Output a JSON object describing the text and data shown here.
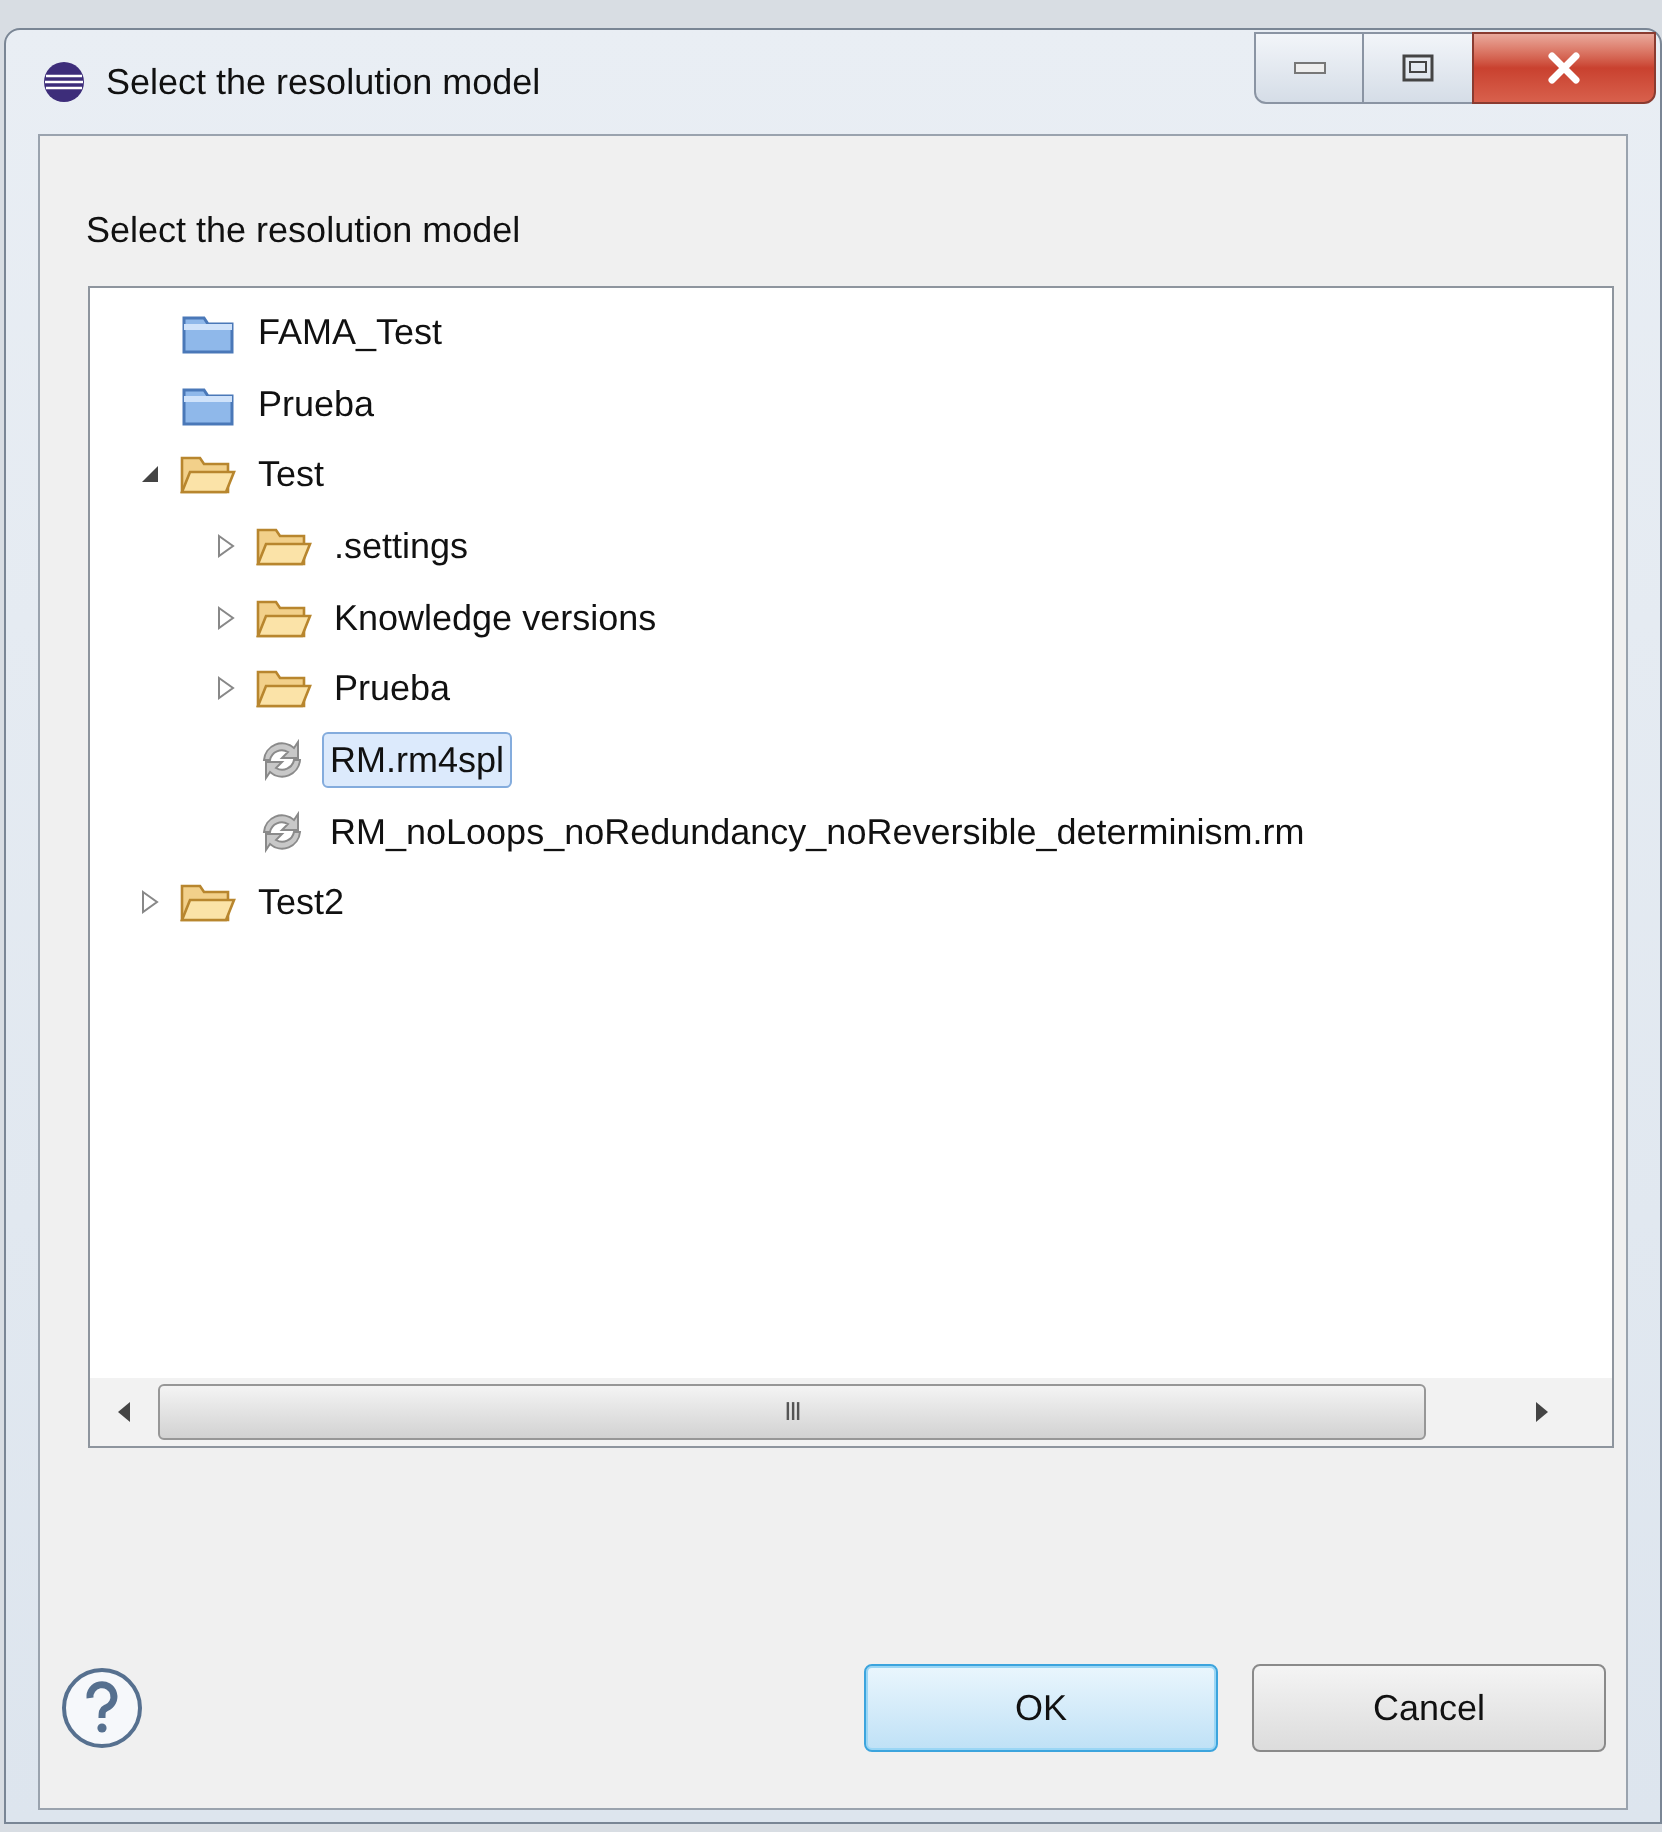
{
  "window": {
    "title": "Select the resolution model"
  },
  "message": "Select the resolution model",
  "tree": [
    {
      "label": "FAMA_Test",
      "kind": "project",
      "selected": false
    },
    {
      "label": "Prueba",
      "kind": "project",
      "selected": false
    },
    {
      "label": "Test",
      "kind": "folder",
      "expanded": true,
      "selected": false,
      "children": [
        {
          "label": ".settings",
          "kind": "folder",
          "expanded": false,
          "selected": false
        },
        {
          "label": "Knowledge versions",
          "kind": "folder",
          "expanded": false,
          "selected": false
        },
        {
          "label": "Prueba",
          "kind": "folder",
          "expanded": false,
          "selected": false
        },
        {
          "label": "RM.rm4spl",
          "kind": "file",
          "selected": true
        },
        {
          "label": "RM_noLoops_noRedundancy_noReversible_determinism.rm",
          "kind": "file",
          "selected": false
        }
      ]
    },
    {
      "label": "Test2",
      "kind": "folder",
      "expanded": false,
      "selected": false
    }
  ],
  "scrollbar_grip": "III",
  "buttons": [
    {
      "label": "OK",
      "default": true
    },
    {
      "label": "Cancel",
      "default": false
    }
  ]
}
